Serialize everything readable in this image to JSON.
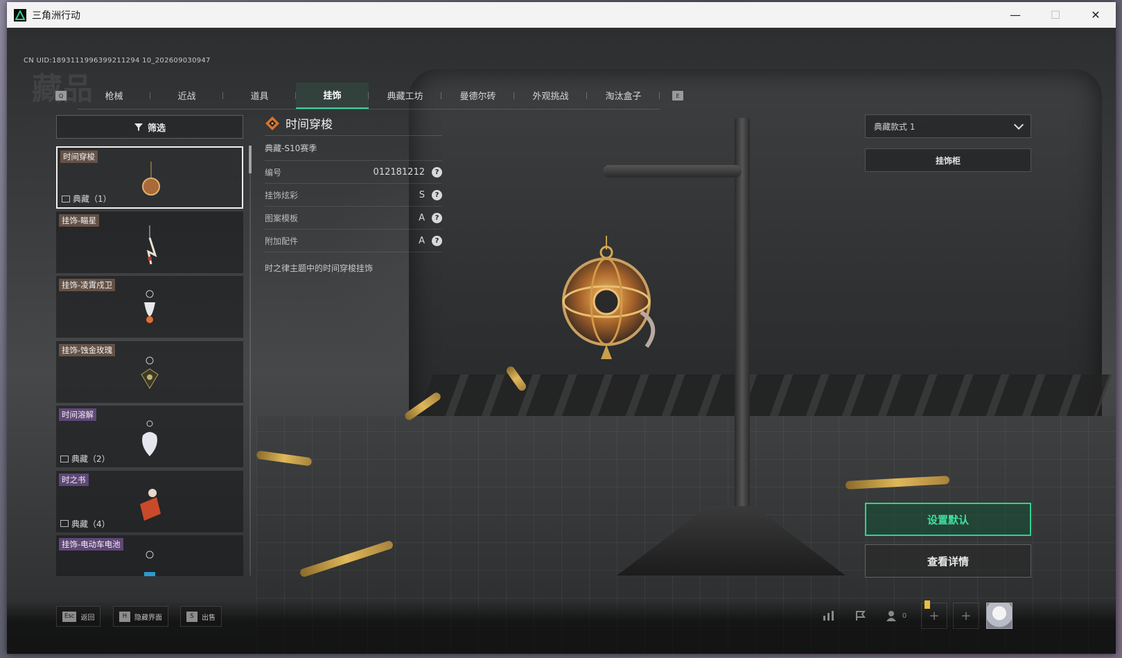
{
  "window": {
    "title": "三角洲行动",
    "controls": [
      "minimize",
      "maximize",
      "close"
    ]
  },
  "uid": "CN UID:1893111996399211294 10_202609030947",
  "bg_title": "藏品",
  "tabs": {
    "left_key": "Q",
    "right_key": "E",
    "active_index": 3,
    "items": [
      "枪械",
      "近战",
      "道具",
      "挂饰",
      "典藏工坊",
      "曼德尔砖",
      "外观挑战",
      "淘汰盒子"
    ]
  },
  "filter": {
    "label": "筛选"
  },
  "items": [
    {
      "name": "时间穿梭",
      "tag_color": "brown",
      "footer": "典藏（1）",
      "selected": true
    },
    {
      "name": "挂饰-瞄星",
      "tag_color": "brown",
      "footer": ""
    },
    {
      "name": "挂饰-凌霄戍卫",
      "tag_color": "brown",
      "footer": ""
    },
    {
      "name": "挂饰-蚀金玫瑰",
      "tag_color": "brown",
      "footer": ""
    },
    {
      "name": "时间溶解",
      "tag_color": "purple",
      "footer": "典藏（2）"
    },
    {
      "name": "时之书",
      "tag_color": "purple",
      "footer": "典藏（4）"
    },
    {
      "name": "挂饰-电动车电池",
      "tag_color": "purple",
      "footer": ""
    }
  ],
  "detail": {
    "title": "时间穿梭",
    "season": "典藏-S10赛季",
    "props": [
      {
        "label": "编号",
        "value": "012181212"
      },
      {
        "label": "挂饰炫彩",
        "value": "S"
      },
      {
        "label": "图案模板",
        "value": "A"
      },
      {
        "label": "附加配件",
        "value": "A"
      }
    ],
    "help_glyph": "?",
    "description": "时之律主题中的时间穿梭挂饰"
  },
  "right_panel": {
    "style_select": "典藏款式 1",
    "cabinet_button": "挂饰柜",
    "set_default_button": "设置默认",
    "view_details_button": "查看详情"
  },
  "hints": [
    {
      "key": "Esc",
      "label": "返回"
    },
    {
      "key": "H",
      "label": "隐藏界面"
    },
    {
      "key": "S",
      "label": "出售"
    }
  ],
  "tray": {
    "friends_count": "0"
  },
  "colors": {
    "accent": "#2fd28e",
    "tag_brown": "#785f50",
    "tag_purple": "#6e508c"
  }
}
